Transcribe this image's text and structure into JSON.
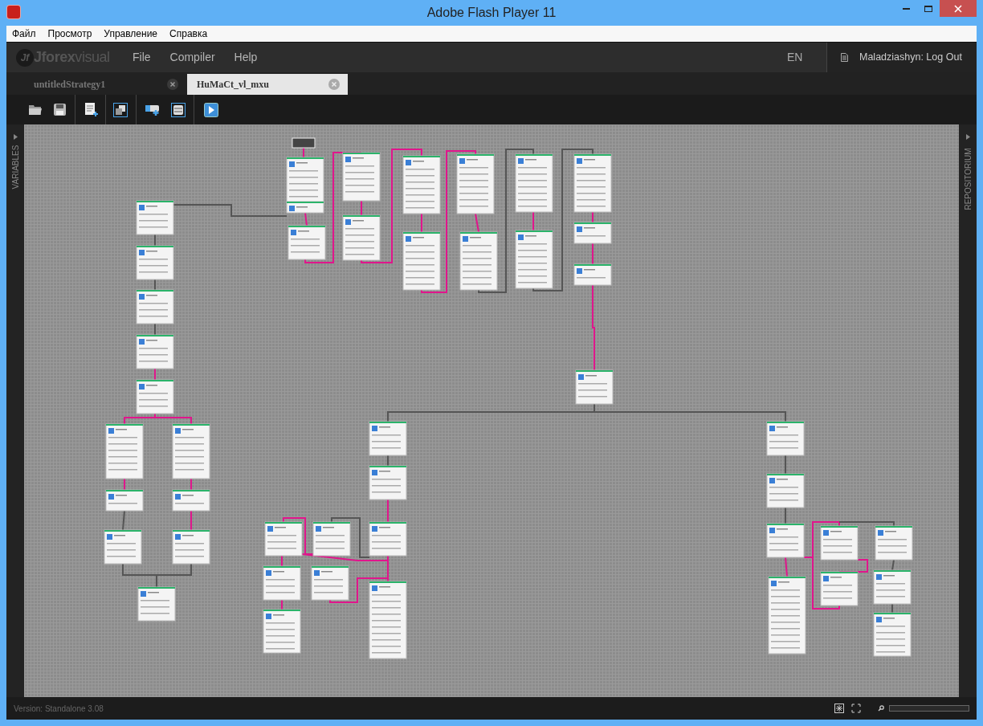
{
  "window": {
    "title": "Adobe Flash Player 11"
  },
  "menu_bar": [
    "Файл",
    "Просмотр",
    "Управление",
    "Справка"
  ],
  "app_header": {
    "logo": {
      "mark": "Jf",
      "name": "Jforex",
      "suffix": "visual"
    },
    "menu": [
      "File",
      "Compiler",
      "Help"
    ],
    "language": "EN",
    "user_link": "Maladziashyn: Log Out"
  },
  "tabs": [
    {
      "label": "untitledStrategy1",
      "selected": false
    },
    {
      "label": "HuMaCt_vl_mxu",
      "selected": true
    }
  ],
  "side_panels": {
    "left": "VARIABLES",
    "right": "REPOSITORIUM"
  },
  "status_bar": {
    "version": "Version: Standalone 3.08"
  }
}
